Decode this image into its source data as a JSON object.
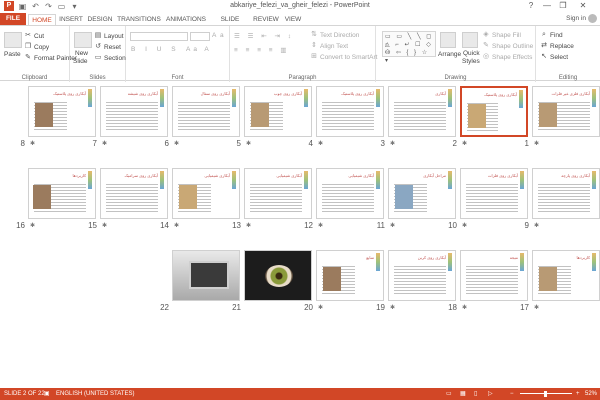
{
  "window": {
    "title": "abkariye_felezi_va_gheir_felezi - PowerPoint",
    "logo": "P",
    "help": "?",
    "minimize": "—",
    "restore": "❐",
    "close": "✕"
  },
  "tabs": [
    "FILE",
    "HOME",
    "INSERT",
    "DESIGN",
    "TRANSITIONS",
    "ANIMATIONS",
    "SLIDE SHOW",
    "REVIEW",
    "VIEW"
  ],
  "active_tab": "HOME",
  "signin": "Sign in",
  "ribbon": {
    "clipboard": {
      "label": "Clipboard",
      "paste": "Paste",
      "cut": "Cut",
      "copy": "Copy",
      "format_painter": "Format Painter"
    },
    "slides": {
      "label": "Slides",
      "new_slide": "New",
      "new_slide2": "Slide",
      "layout": "Layout",
      "reset": "Reset",
      "section": "Section"
    },
    "font": {
      "label": "Font"
    },
    "paragraph": {
      "label": "Paragraph",
      "text_direction": "Text Direction",
      "align_text": "Align Text",
      "convert_smartart": "Convert to SmartArt"
    },
    "drawing": {
      "label": "Drawing",
      "arrange": "Arrange",
      "quick_styles": "Quick",
      "quick_styles2": "Styles",
      "shape_fill": "Shape Fill",
      "shape_outline": "Shape Outline",
      "shape_effects": "Shape Effects"
    },
    "editing": {
      "label": "Editing",
      "find": "Find",
      "replace": "Replace",
      "select": "Select"
    }
  },
  "slides": [
    {
      "num": "1",
      "title": "آبکاری فلزی غیر فلزات"
    },
    {
      "num": "2",
      "title": "آبکاری روی پلاستیک"
    },
    {
      "num": "3",
      "title": "آبکاری"
    },
    {
      "num": "4",
      "title": "آبکاری روی پلاستیک"
    },
    {
      "num": "5",
      "title": "آبکاری روی چوب"
    },
    {
      "num": "6",
      "title": "آبکاری روی سفال"
    },
    {
      "num": "7",
      "title": "آبکاری روی شیشه"
    },
    {
      "num": "8",
      "title": "آبکاری روی پلاستیک"
    },
    {
      "num": "9",
      "title": "آبکاری روی پارچه"
    },
    {
      "num": "10",
      "title": "آبکاری روی فلزات"
    },
    {
      "num": "11",
      "title": "مراحل آبکاری"
    },
    {
      "num": "12",
      "title": "آبکاری شیمیایی"
    },
    {
      "num": "13",
      "title": "آبکاری شیمیایی"
    },
    {
      "num": "14",
      "title": "آبکاری شیمیایی"
    },
    {
      "num": "15",
      "title": "آبکاری روی سرامیک"
    },
    {
      "num": "16",
      "title": "کاربردها"
    },
    {
      "num": "17",
      "title": "کاربردها"
    },
    {
      "num": "18",
      "title": "نتیجه"
    },
    {
      "num": "19",
      "title": "آبکاری روی کربن"
    },
    {
      "num": "20",
      "title": "منابع"
    },
    {
      "num": "21",
      "title": ""
    },
    {
      "num": "22",
      "title": ""
    }
  ],
  "selected_slide": "2",
  "status": {
    "slide_info": "SLIDE 2 OF 22",
    "language": "ENGLISH (UNITED STATES)",
    "zoom": "52%"
  },
  "colors": {
    "accent": "#d24726"
  }
}
